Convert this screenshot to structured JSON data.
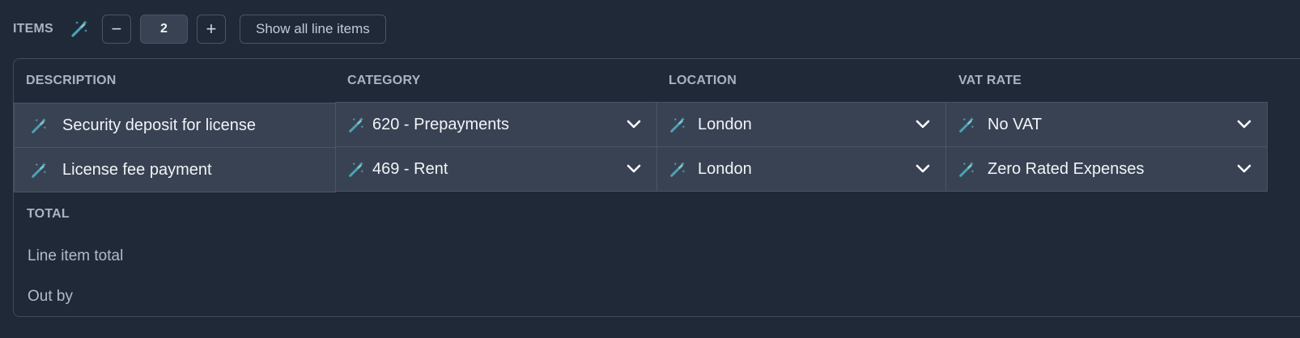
{
  "toolbar": {
    "items_label": "ITEMS",
    "decrement_label": "−",
    "quantity": "2",
    "increment_label": "+",
    "show_all_label": "Show all line items"
  },
  "table": {
    "headers": [
      "DESCRIPTION",
      "CATEGORY",
      "LOCATION",
      "VAT RATE"
    ],
    "rows": [
      {
        "description": "Security deposit for license",
        "category": "620 - Prepayments",
        "location": "London",
        "vat_rate": "No VAT"
      },
      {
        "description": "License fee payment",
        "category": "469 - Rent",
        "location": "London",
        "vat_rate": "Zero Rated Expenses"
      }
    ],
    "total_label": "TOTAL",
    "line_item_total_label": "Line item total",
    "out_by_label": "Out by"
  },
  "icons": {
    "ai_suggestion": "magic-wand-icon",
    "dropdown": "chevron-down-icon"
  },
  "colors": {
    "background": "#202938",
    "cell_background": "#394253",
    "wand_accent": "#4aa3b5",
    "header_text": "#aab3c0"
  }
}
